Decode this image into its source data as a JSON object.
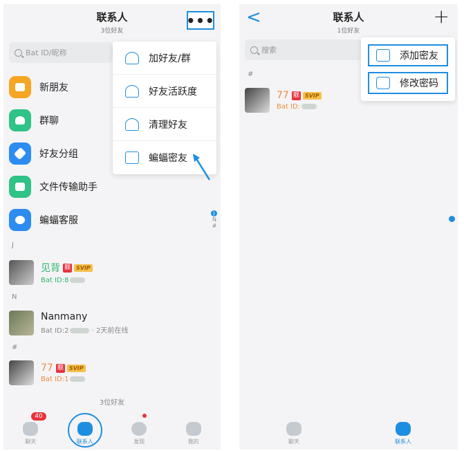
{
  "left": {
    "header": {
      "title": "联系人",
      "subtitle": "3位好友",
      "more_label": "•••"
    },
    "search": {
      "placeholder": "Bat ID/昵称"
    },
    "entries": [
      {
        "label": "新朋友",
        "icon": "new-friends-icon",
        "color": "#f5a623"
      },
      {
        "label": "群聊",
        "icon": "group-chat-icon",
        "color": "#2fc387"
      },
      {
        "label": "好友分组",
        "icon": "tag-icon",
        "color": "#2d8cf0"
      },
      {
        "label": "文件传输助手",
        "icon": "file-transfer-icon",
        "color": "#2fc387"
      },
      {
        "label": "蝙蝠客服",
        "icon": "customer-service-icon",
        "color": "#2d8cf0"
      }
    ],
    "sections": {
      "j": "J",
      "n": "N",
      "hash": "#"
    },
    "contacts": [
      {
        "name": "见背",
        "badge_liang": "靓",
        "badge_svip": "SVIP",
        "id": "Bat ID:8"
      },
      {
        "name": "Nanmany",
        "id": "Bat ID:2",
        "status": "· 2天前在线"
      },
      {
        "name": "77",
        "badge_liang": "靓",
        "badge_svip": "SVIP",
        "id": "Bat ID:1"
      }
    ],
    "index": {
      "dot": "J",
      "n": "N",
      "hash": "#"
    },
    "footer_count": "3位好友",
    "menu": [
      {
        "label": "加好友/群",
        "icon": "add-friend-icon"
      },
      {
        "label": "好友活跃度",
        "icon": "friend-activity-icon"
      },
      {
        "label": "清理好友",
        "icon": "clean-friends-icon"
      },
      {
        "label": "蝙蝠密友",
        "icon": "bat-close-friend-icon"
      }
    ],
    "tabs": [
      {
        "label": "聊天",
        "badge": "40"
      },
      {
        "label": "联系人"
      },
      {
        "label": "发现"
      },
      {
        "label": "我的"
      }
    ]
  },
  "right": {
    "header": {
      "title": "联系人",
      "subtitle": "1位好友",
      "back_label": "<",
      "plus_label": "+"
    },
    "search": {
      "placeholder": "搜索"
    },
    "section": "#",
    "contacts": [
      {
        "name": "77",
        "badge_liang": "靓",
        "badge_svip": "SVIP",
        "id": "Bat ID:"
      }
    ],
    "menu": [
      {
        "label": "添加密友",
        "icon": "bat-icon"
      },
      {
        "label": "修改密码",
        "icon": "lock-icon"
      }
    ],
    "tabs": [
      {
        "label": "聊天"
      },
      {
        "label": "联系人"
      }
    ]
  },
  "colors": {
    "accent": "#1e8ee0",
    "badge_red": "#e8323c",
    "svip_gold": "#f6c04a"
  }
}
